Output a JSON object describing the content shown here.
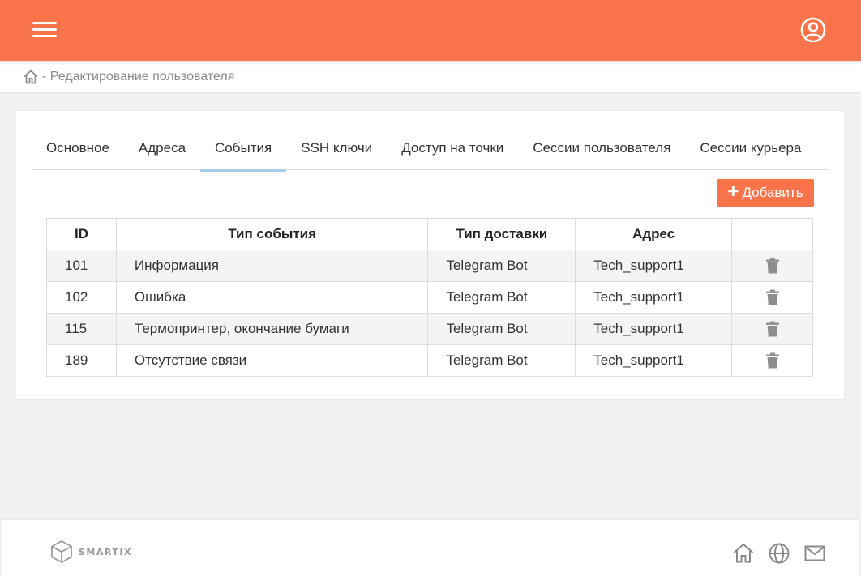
{
  "colors": {
    "accent": "#f9744a",
    "tab_indicator": "#a9cde6",
    "icon_gray": "#8a8a8a"
  },
  "header": {
    "menu_icon": "hamburger-menu-icon",
    "user_icon": "user-circle-icon"
  },
  "breadcrumb": {
    "home_icon": "home-icon",
    "text": "- Редактирование пользователя"
  },
  "tabs": [
    {
      "label": "Основное",
      "active": false
    },
    {
      "label": "Адреса",
      "active": false
    },
    {
      "label": "События",
      "active": true
    },
    {
      "label": "SSH ключи",
      "active": false
    },
    {
      "label": "Доступ на точки",
      "active": false
    },
    {
      "label": "Сессии пользователя",
      "active": false
    },
    {
      "label": "Сессии курьера",
      "active": false
    }
  ],
  "toolbar": {
    "add_label": "Добавить"
  },
  "table": {
    "headers": [
      "ID",
      "Тип события",
      "Тип доставки",
      "Адрес",
      ""
    ],
    "rows": [
      {
        "id": "101",
        "event_type": "Информация",
        "delivery": "Telegram Bot",
        "address": "Tech_support1"
      },
      {
        "id": "102",
        "event_type": "Ошибка",
        "delivery": "Telegram Bot",
        "address": "Tech_support1"
      },
      {
        "id": "115",
        "event_type": "Термопринтер, окончание бумаги",
        "delivery": "Telegram Bot",
        "address": "Tech_support1"
      },
      {
        "id": "189",
        "event_type": "Отсутствие связи",
        "delivery": "Telegram Bot",
        "address": "Tech_support1"
      }
    ]
  },
  "footer": {
    "logo_text": "SMARTIX",
    "icons": [
      "home-icon",
      "globe-icon",
      "mail-icon"
    ]
  }
}
